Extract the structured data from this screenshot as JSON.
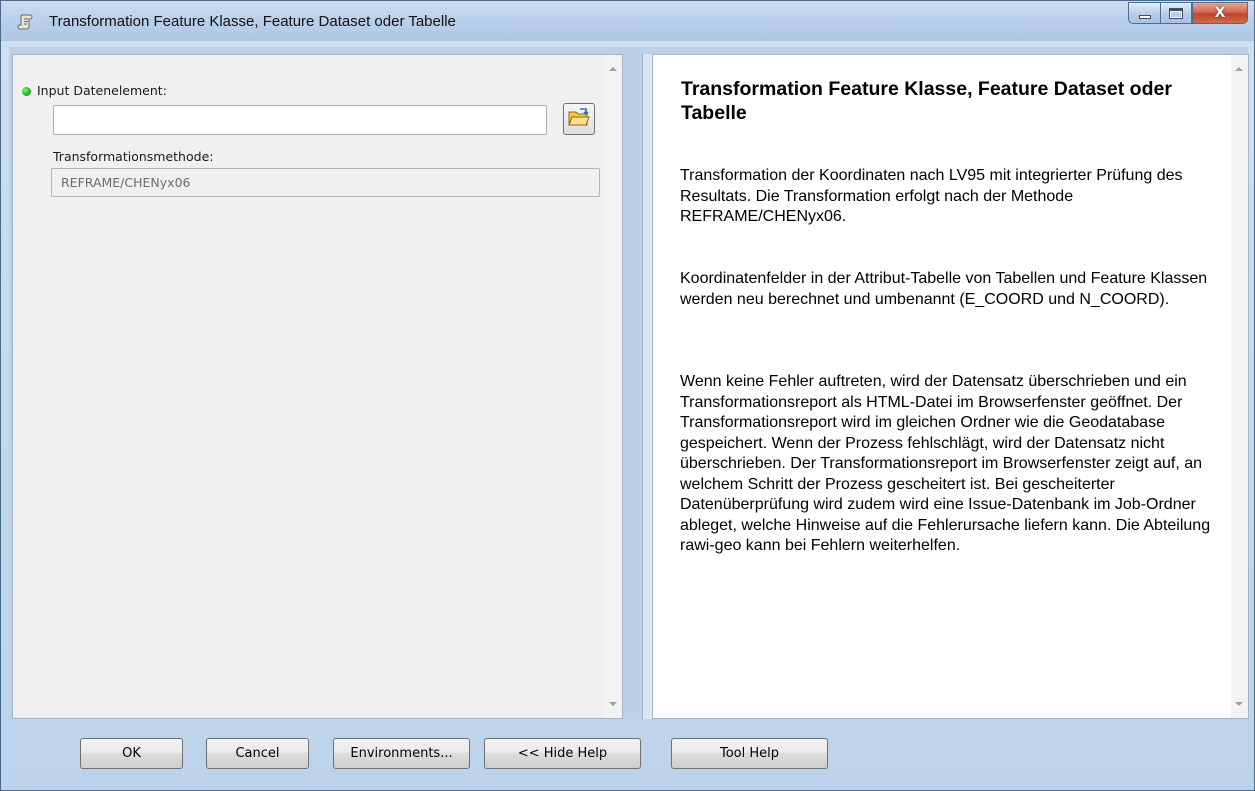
{
  "window": {
    "title": "Transformation Feature Klasse, Feature Dataset oder Tabelle",
    "icon": "script-tool-icon",
    "controls": [
      "minimize-icon",
      "maximize-icon",
      "close-icon"
    ]
  },
  "form": {
    "input_label": "Input Datenelement:",
    "input_value": "",
    "method_label": "Transformationsmethode:",
    "method_value": "REFRAME/CHENyx06",
    "browse_icon": "open-folder-icon"
  },
  "help": {
    "title": "Transformation Feature Klasse, Feature Dataset oder Tabelle",
    "paragraphs": [
      "Transformation der Koordinaten nach LV95 mit integrierter Prüfung des Resultats. Die Transformation erfolgt nach der Methode REFRAME/CHENyx06.",
      "Koordinatenfelder in der Attribut-Tabelle von Tabellen und Feature Klassen werden neu berechnet und umbenannt (E_COORD und N_COORD).",
      "Wenn keine Fehler auftreten, wird der Datensatz überschrieben und ein Transformationsreport als HTML-Datei im Browserfenster geöffnet. Der Transformationsreport wird im gleichen Ordner wie die Geodatabase gespeichert. Wenn der Prozess fehlschlägt, wird der Datensatz nicht überschrieben. Der Transformationsreport im Browserfenster zeigt auf, an welchem Schritt der Prozess gescheitert ist. Bei gescheiterter Datenüberprüfung wird zudem wird eine Issue-Datenbank im Job-Ordner ableget, welche Hinweise auf die Fehlerursache liefern kann. Die Abteilung rawi-geo kann bei Fehlern weiterhelfen."
    ]
  },
  "buttons": {
    "ok": "OK",
    "cancel": "Cancel",
    "environments": "Environments...",
    "hide_help": "<< Hide Help",
    "tool_help": "Tool Help"
  },
  "colors": {
    "required_dot": "#1db51a",
    "close_button": "#c1432b"
  }
}
